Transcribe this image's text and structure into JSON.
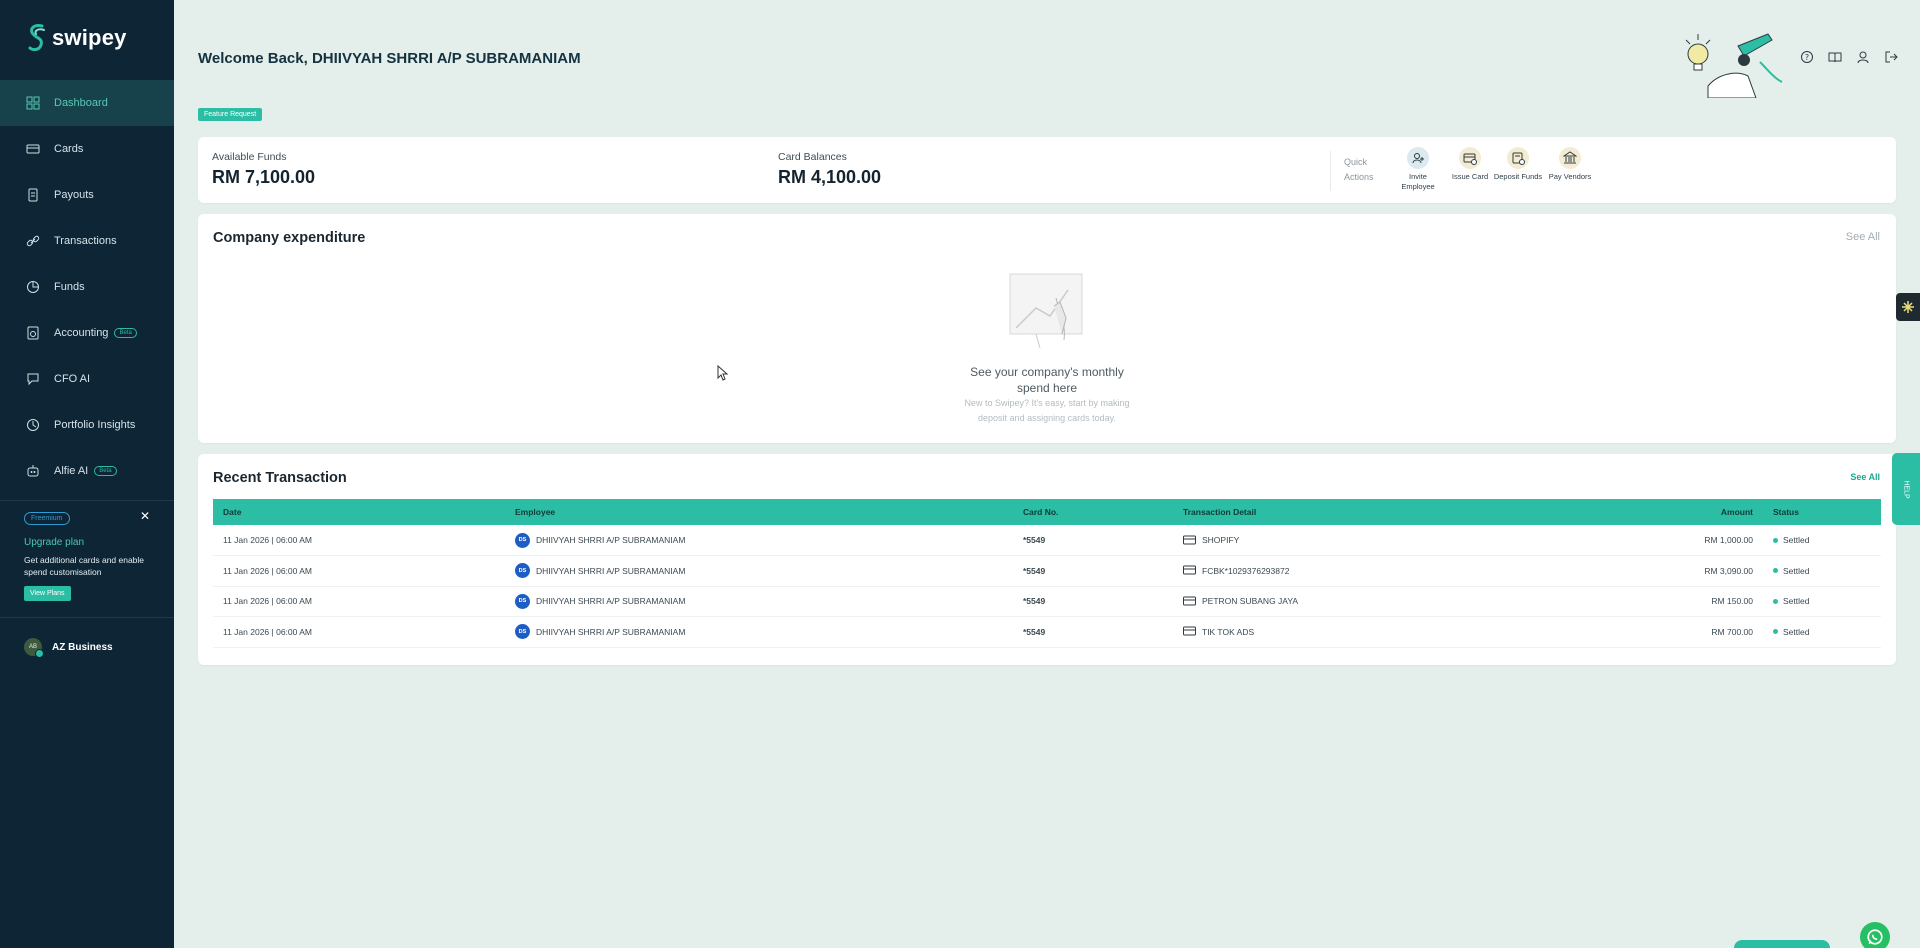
{
  "app": {
    "brand": "swipey"
  },
  "sidebar": {
    "items": [
      {
        "label": "Dashboard",
        "icon": "dashboard-icon",
        "active": true
      },
      {
        "label": "Cards",
        "icon": "card-icon"
      },
      {
        "label": "Payouts",
        "icon": "payouts-icon"
      },
      {
        "label": "Transactions",
        "icon": "link-icon"
      },
      {
        "label": "Funds",
        "icon": "pie-icon"
      },
      {
        "label": "Accounting",
        "icon": "document-icon",
        "badge": "Beta"
      },
      {
        "label": "CFO AI",
        "icon": "chat-icon"
      },
      {
        "label": "Portfolio Insights",
        "icon": "insights-icon"
      },
      {
        "label": "Alfie AI",
        "icon": "robot-icon",
        "badge": "Beta"
      }
    ],
    "upgrade": {
      "badge": "Freemium",
      "title": "Upgrade plan",
      "description": "Get additional cards and enable spend customisation",
      "button": "View Plans"
    },
    "business": {
      "avatar": "AB",
      "name": "AZ Business"
    }
  },
  "header": {
    "welcome": "Welcome Back, DHIIVYAH SHRRI A/P SUBRAMANIAM",
    "feature_request": "Feature Request"
  },
  "funds": {
    "available_label": "Available Funds",
    "available_value": "RM 7,100.00",
    "balances_label": "Card Balances",
    "balances_value": "RM 4,100.00",
    "quick_actions_label": "Quick Actions",
    "quick_actions": [
      {
        "label": "Invite Employee",
        "icon": "invite-employee-icon"
      },
      {
        "label": "Issue Card",
        "icon": "issue-card-icon"
      },
      {
        "label": "Deposit Funds",
        "icon": "deposit-funds-icon"
      },
      {
        "label": "Pay Vendors",
        "icon": "pay-vendors-icon"
      }
    ]
  },
  "expenditure": {
    "title": "Company expenditure",
    "see_all": "See All",
    "empty_title": "See your company's monthly spend here",
    "empty_desc": "New to Swipey? It's easy, start by making deposit and assigning cards today."
  },
  "transactions": {
    "title": "Recent Transaction",
    "see_all": "See All",
    "columns": [
      "Date",
      "Employee",
      "Card No.",
      "Transaction Detail",
      "Amount",
      "Status"
    ],
    "rows": [
      {
        "date": "11 Jan 2026 | 06:00 AM",
        "initials": "DS",
        "employee": "DHIIVYAH SHRRI A/P SUBRAMANIAM",
        "card": "*5549",
        "detail": "SHOPIFY",
        "amount": "RM 1,000.00",
        "status": "Settled"
      },
      {
        "date": "11 Jan 2026 | 06:00 AM",
        "initials": "DS",
        "employee": "DHIIVYAH SHRRI A/P SUBRAMANIAM",
        "card": "*5549",
        "detail": "FCBK*1029376293872",
        "amount": "RM 3,090.00",
        "status": "Settled"
      },
      {
        "date": "11 Jan 2026 | 06:00 AM",
        "initials": "DS",
        "employee": "DHIIVYAH SHRRI A/P SUBRAMANIAM",
        "card": "*5549",
        "detail": "PETRON SUBANG JAYA",
        "amount": "RM 150.00",
        "status": "Settled"
      },
      {
        "date": "11 Jan 2026 | 06:00 AM",
        "initials": "DS",
        "employee": "DHIIVYAH SHRRI A/P SUBRAMANIAM",
        "card": "*5549",
        "detail": "TIK TOK ADS",
        "amount": "RM 700.00",
        "status": "Settled"
      }
    ]
  },
  "widgets": {
    "help_label": "HELP"
  },
  "colors": {
    "accent": "#2cbea4",
    "sidebar": "#0e2536",
    "background": "#e4efec"
  }
}
